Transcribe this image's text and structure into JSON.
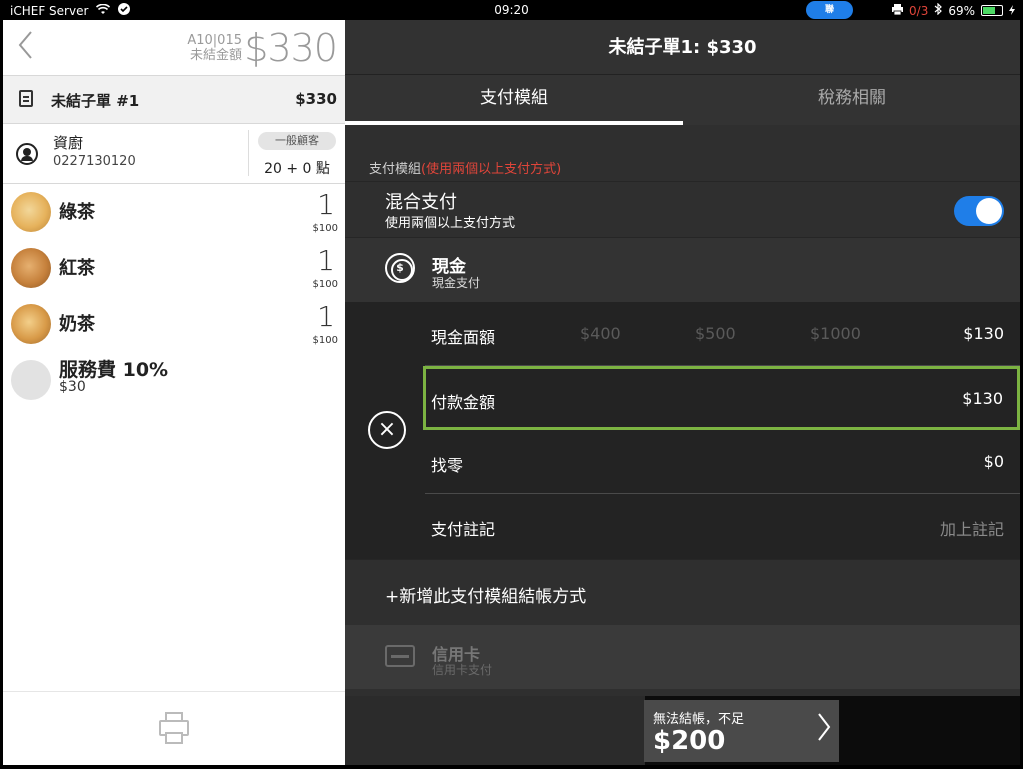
{
  "status_bar": {
    "carrier": "iCHEF Server",
    "time": "09:20",
    "pill_label": "聯",
    "printer_count": "0/3",
    "battery": "69%",
    "battery_level": 0.69
  },
  "order": {
    "table_number": "A10|015",
    "unpaid_label": "未結金額",
    "unpaid_amount": "$330",
    "sub_bill_title": "未結子單 #1",
    "sub_bill_amount": "$330"
  },
  "customer": {
    "name": "資廚",
    "phone": "0227130120",
    "badge": "一般顧客",
    "points": "20 + 0 點"
  },
  "items": [
    {
      "name": "綠茶",
      "qty": "1",
      "price": "$100",
      "color": "#e6b25c"
    },
    {
      "name": "紅茶",
      "qty": "1",
      "price": "$100",
      "color": "#c6813c"
    },
    {
      "name": "奶茶",
      "qty": "1",
      "price": "$100",
      "color": "#d89a48"
    }
  ],
  "service_fee": {
    "name": "服務費 10%",
    "amount": "$30"
  },
  "payment": {
    "title": "未結子單1: $330",
    "tabs": [
      "支付模組",
      "稅務相關"
    ],
    "section_label": "支付模組",
    "section_warning": "(使用兩個以上支付方式)",
    "mixed_title": "混合支付",
    "mixed_subtitle": "使用兩個以上支付方式",
    "mixed_enabled": true,
    "cash_title": "現金",
    "cash_subtitle": "現金支付",
    "cash_icon_glyph": "$",
    "denomination_label": "現金面額",
    "denominations": [
      "$400",
      "$500",
      "$1000"
    ],
    "denomination_value": "$130",
    "pay_amount_label": "付款金額",
    "pay_amount_value": "$130",
    "change_label": "找零",
    "change_value": "$0",
    "note_label": "支付註記",
    "note_placeholder": "加上註記",
    "add_method_label": "+新增此支付模組結帳方式",
    "credit_title": "信用卡",
    "credit_subtitle": "信用卡支付",
    "checkout_label": "無法結帳，不足",
    "checkout_amount": "$200"
  }
}
